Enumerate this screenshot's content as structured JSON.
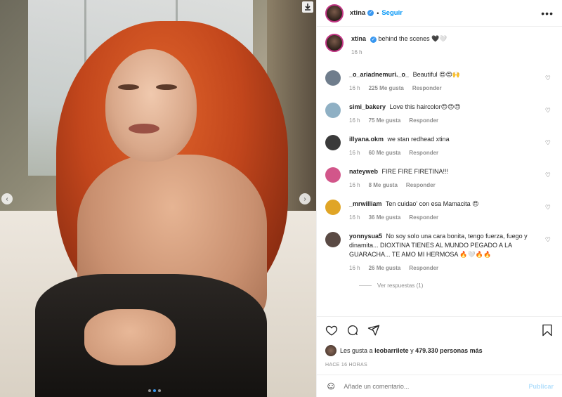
{
  "post": {
    "author": "xtina",
    "follow_label": "Seguir",
    "separator": "•",
    "more_label": "•••",
    "caption": "behind the scenes 🖤🤍",
    "caption_time": "16 h"
  },
  "comments": [
    {
      "user": "_o_ariadnemuri._o_",
      "text": "Beautiful 😍😍🙌",
      "time": "16 h",
      "likes": "225 Me gusta",
      "reply": "Responder",
      "avatar_color": "#6f7d8c"
    },
    {
      "user": "simi_bakery",
      "text": "Love this haircolor😍😍😍",
      "time": "16 h",
      "likes": "75 Me gusta",
      "reply": "Responder",
      "avatar_color": "#8fb0c4"
    },
    {
      "user": "illyana.okm",
      "text": "we stan redhead xtina",
      "time": "16 h",
      "likes": "60 Me gusta",
      "reply": "Responder",
      "avatar_color": "#3a3a3a"
    },
    {
      "user": "nateyweb",
      "text": "FIRE FIRE FIRETINA!!!",
      "time": "16 h",
      "likes": "8 Me gusta",
      "reply": "Responder",
      "avatar_color": "#d2568a"
    },
    {
      "user": "_mrwilliam",
      "text": "Ten cuidao' con esa Mamacita 😍",
      "time": "16 h",
      "likes": "36 Me gusta",
      "reply": "Responder",
      "avatar_color": "#e0a526"
    },
    {
      "user": "yonnysua5",
      "text": "No soy solo una cara bonita, tengo fuerza, fuego y dinamita... DIOXTINA TIENES AL MUNDO PEGADO A LA GUARACHA... TE AMO MI HERMOSA 🔥🤍🔥🔥",
      "time": "16 h",
      "likes": "26 Me gusta",
      "reply": "Responder",
      "avatar_color": "#5a4a44"
    }
  ],
  "view_replies": "Ver respuestas (1)",
  "likes_line": {
    "prefix": "Les gusta a ",
    "user": "leobarrilete",
    "middle": " y ",
    "count": "479.330 personas más"
  },
  "time_ago": "HACE 16 HORAS",
  "add_comment": {
    "placeholder": "Añade un comentario...",
    "post_label": "Publicar"
  },
  "icons": {
    "download": "download-icon",
    "like": "heart-icon",
    "comment": "comment-icon",
    "share": "share-icon",
    "save": "bookmark-icon",
    "emoji": "smiley-icon"
  },
  "colors": {
    "accent": "#0095f6",
    "verified": "#3897f0",
    "muted": "#8e8e8e"
  }
}
